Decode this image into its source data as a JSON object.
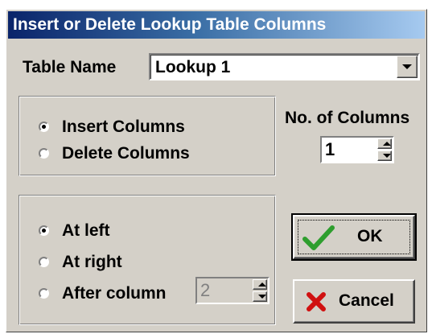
{
  "window": {
    "title": "Insert or Delete Lookup Table Columns"
  },
  "table_name": {
    "label": "Table Name",
    "value": "Lookup 1"
  },
  "operation_group": {
    "options": [
      {
        "label": "Insert Columns",
        "selected": true
      },
      {
        "label": "Delete Columns",
        "selected": false
      }
    ]
  },
  "columns_count": {
    "label": "No. of Columns",
    "value": "1"
  },
  "position_group": {
    "options": [
      {
        "label": "At left",
        "selected": true
      },
      {
        "label": "At right",
        "selected": false
      },
      {
        "label": "After column",
        "selected": false
      }
    ],
    "after_column_value": "2"
  },
  "buttons": {
    "ok": "OK",
    "cancel": "Cancel"
  },
  "icons": {
    "ok": "checkmark-icon",
    "cancel": "x-icon"
  },
  "colors": {
    "titlebar_start": "#0a246a",
    "titlebar_end": "#a6caf0",
    "face": "#d4d0c8",
    "ok_check": "#2e9e2e",
    "cancel_x": "#d01010"
  }
}
